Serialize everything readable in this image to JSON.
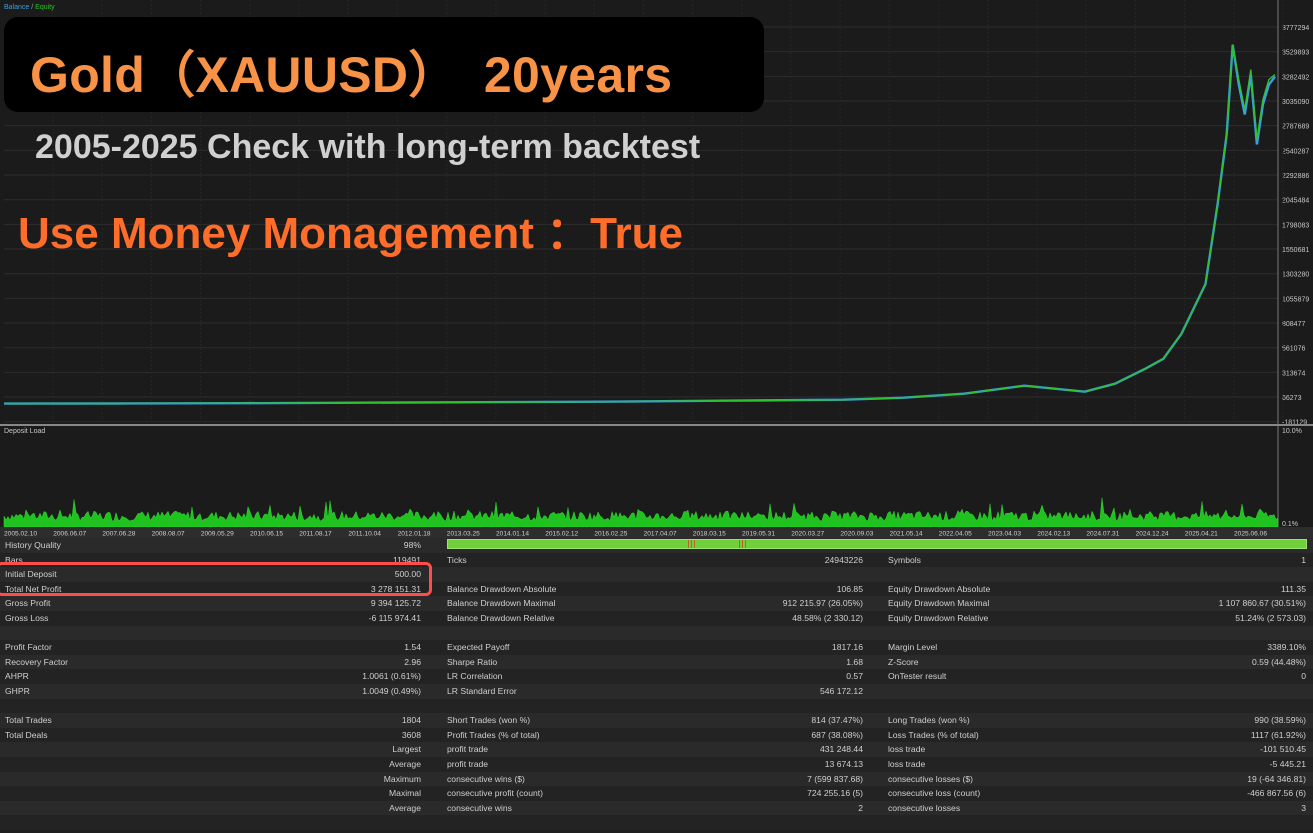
{
  "legend": {
    "balance": "Balance",
    "separator": "/",
    "equity": "Equity"
  },
  "overlay": {
    "title": "Gold（XAUUSD）　20years",
    "subtitle": "2005-2025 Check with long-term backtest",
    "money_management": "Use Money Monagement ：True"
  },
  "colors": {
    "balance": "#3aa0e0",
    "equity": "#2fbf2f",
    "title_orange": "#f79246",
    "mm_orange": "#ff6d2a",
    "highlight": "#ff4d4d"
  },
  "balance_axis": [
    "3777294",
    "3529893",
    "3282492",
    "3035090",
    "2787689",
    "2540287",
    "2292886",
    "2045484",
    "1798083",
    "1550681",
    "1303280",
    "1055879",
    "808477",
    "561076",
    "313674",
    "66273",
    "-181129"
  ],
  "deposit_load": {
    "title": "Deposit Load",
    "axis": [
      "10.0%",
      "0.1%"
    ]
  },
  "dates": [
    "2005.02.10",
    "2006.06.07",
    "2007.06.28",
    "2008.08.07",
    "2009.05.29",
    "2010.06.15",
    "2011.08.17",
    "2011.10.04",
    "2012.01.18",
    "2013.03.25",
    "2014.01.14",
    "2015.02.12",
    "2016.02.25",
    "2017.04.07",
    "2018.03.15",
    "2019.05.31",
    "2020.03.27",
    "2020.09.03",
    "2021.05.14",
    "2022.04.05",
    "2023.04.03",
    "2024.02.13",
    "2024.07.31",
    "2024.12.24",
    "2025.04.21",
    "2025.06.06"
  ],
  "chart_data": [
    {
      "type": "line",
      "title": "",
      "xlabel": "",
      "ylabel": "",
      "ylim": [
        -181129,
        3777294
      ],
      "x_range": [
        "2005.02.10",
        "2025.06.06"
      ],
      "x": [
        2005.1,
        2007,
        2009,
        2011,
        2013,
        2015,
        2017,
        2019,
        2020,
        2021,
        2022,
        2023,
        2023.5,
        2024,
        2024.3,
        2024.6,
        2024.8,
        2025.0,
        2025.2,
        2025.35,
        2025.45,
        2025.55,
        2025.65,
        2025.75,
        2025.85,
        2025.95,
        2026.05,
        2026.15
      ],
      "series": [
        {
          "name": "Balance",
          "values": [
            500,
            2000,
            5000,
            10000,
            15000,
            20000,
            30000,
            40000,
            60000,
            100000,
            180000,
            120000,
            200000,
            350000,
            450000,
            700000,
            950000,
            1200000,
            2000000,
            2700000,
            3600000,
            3200000,
            2900000,
            3300000,
            2600000,
            3000000,
            3200000,
            3278651
          ]
        },
        {
          "name": "Equity",
          "values": [
            500,
            2000,
            5000,
            10000,
            15000,
            20000,
            30000,
            40000,
            60000,
            100000,
            180000,
            120000,
            200000,
            350000,
            450000,
            700000,
            950000,
            1200000,
            2000000,
            2700000,
            3600000,
            3250000,
            2950000,
            3350000,
            2650000,
            3050000,
            3250000,
            3300000
          ]
        }
      ],
      "grid": true
    },
    {
      "type": "bar",
      "title": "Deposit Load",
      "ylim": [
        0.1,
        10.0
      ],
      "x_range": [
        "2005.02.10",
        "2025.06.06"
      ],
      "note_values": "dense bars of roughly 1-2.5% load across the whole period"
    }
  ],
  "report": {
    "rows": [
      {
        "c1l": "History Quality",
        "c1v": "98%",
        "c2l": "",
        "c2v": "",
        "c3l": "",
        "c3v": "",
        "quality_bar": true
      },
      {
        "c1l": "Bars",
        "c1v": "119491",
        "c2l": "Ticks",
        "c2v": "24943226",
        "c3l": "Symbols",
        "c3v": "1"
      },
      {
        "c1l": "Initial Deposit",
        "c1v": "500.00",
        "c2l": "",
        "c2v": "",
        "c3l": "",
        "c3v": ""
      },
      {
        "c1l": "Total Net Profit",
        "c1v": "3 278 151.31",
        "c2l": "Balance Drawdown Absolute",
        "c2v": "106.85",
        "c3l": "Equity Drawdown Absolute",
        "c3v": "111.35"
      },
      {
        "c1l": "Gross Profit",
        "c1v": "9 394 125.72",
        "c2l": "Balance Drawdown Maximal",
        "c2v": "912 215.97 (26.05%)",
        "c3l": "Equity Drawdown Maximal",
        "c3v": "1 107 860.67 (30.51%)"
      },
      {
        "c1l": "Gross Loss",
        "c1v": "-6 115 974.41",
        "c2l": "Balance Drawdown Relative",
        "c2v": "48.58% (2 330.12)",
        "c3l": "Equity Drawdown Relative",
        "c3v": "51.24% (2 573.03)"
      },
      {
        "c1l": "",
        "c1v": "",
        "c2l": "",
        "c2v": "",
        "c3l": "",
        "c3v": ""
      },
      {
        "c1l": "Profit Factor",
        "c1v": "1.54",
        "c2l": "Expected Payoff",
        "c2v": "1817.16",
        "c3l": "Margin Level",
        "c3v": "3389.10%"
      },
      {
        "c1l": "Recovery Factor",
        "c1v": "2.96",
        "c2l": "Sharpe Ratio",
        "c2v": "1.68",
        "c3l": "Z-Score",
        "c3v": "0.59 (44.48%)"
      },
      {
        "c1l": "AHPR",
        "c1v": "1.0061 (0.61%)",
        "c2l": "LR Correlation",
        "c2v": "0.57",
        "c3l": "OnTester result",
        "c3v": "0"
      },
      {
        "c1l": "GHPR",
        "c1v": "1.0049 (0.49%)",
        "c2l": "LR Standard Error",
        "c2v": "546 172.12",
        "c3l": "",
        "c3v": ""
      },
      {
        "c1l": "",
        "c1v": "",
        "c2l": "",
        "c2v": "",
        "c3l": "",
        "c3v": ""
      },
      {
        "c1l": "Total Trades",
        "c1v": "1804",
        "c2l": "Short Trades (won %)",
        "c2v": "814 (37.47%)",
        "c3l": "Long Trades (won %)",
        "c3v": "990 (38.59%)"
      },
      {
        "c1l": "Total Deals",
        "c1v": "3608",
        "c2l": "Profit Trades (% of total)",
        "c2v": "687 (38.08%)",
        "c3l": "Loss Trades (% of total)",
        "c3v": "1117 (61.92%)"
      },
      {
        "c1l": "",
        "c1v": "Largest",
        "c2l": "profit trade",
        "c2v": "431 248.44",
        "c3l": "loss trade",
        "c3v": "-101 510.45"
      },
      {
        "c1l": "",
        "c1v": "Average",
        "c2l": "profit trade",
        "c2v": "13 674.13",
        "c3l": "loss trade",
        "c3v": "-5 445.21"
      },
      {
        "c1l": "",
        "c1v": "Maximum",
        "c2l": "consecutive wins ($)",
        "c2v": "7 (599 837.68)",
        "c3l": "consecutive losses ($)",
        "c3v": "19 (-64 346.81)"
      },
      {
        "c1l": "",
        "c1v": "Maximal",
        "c2l": "consecutive profit (count)",
        "c2v": "724 255.16 (5)",
        "c3l": "consecutive loss (count)",
        "c3v": "-466 867.56 (6)"
      },
      {
        "c1l": "",
        "c1v": "Average",
        "c2l": "consecutive wins",
        "c2v": "2",
        "c3l": "consecutive losses",
        "c3v": "3"
      },
      {
        "c1l": "",
        "c1v": "",
        "c2l": "",
        "c2v": "",
        "c3l": "",
        "c3v": ""
      }
    ]
  }
}
